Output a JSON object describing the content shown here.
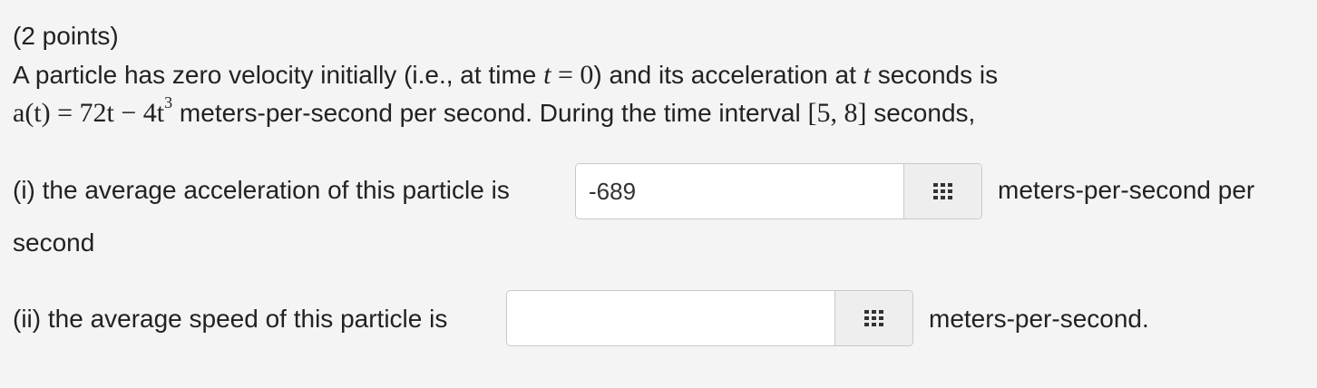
{
  "problem": {
    "points": "(2 points)",
    "line1_a": "A particle has zero velocity initially (i.e., at time",
    "line1_math_var": "t",
    "line1_math_eq": " = 0",
    "line1_b": ") and its acceleration at",
    "line1_math_t": "t",
    "line1_c": "seconds is",
    "line2_math_lhs": "a(t) = 72t − 4t",
    "line2_math_exp": "3",
    "line2_a": "meters-per-second per second. During the time interval",
    "line2_math_interval": "[5, 8]",
    "line2_b": "seconds,"
  },
  "part1": {
    "prompt": "(i) the average acceleration of this particle is",
    "input_value": "-689",
    "units_a": "meters-per-second per",
    "units_b": "second",
    "palette_icon": "grid-icon"
  },
  "part2": {
    "prompt": "(ii) the average speed of this particle is",
    "input_value": "",
    "units": "meters-per-second.",
    "palette_icon": "grid-icon"
  }
}
